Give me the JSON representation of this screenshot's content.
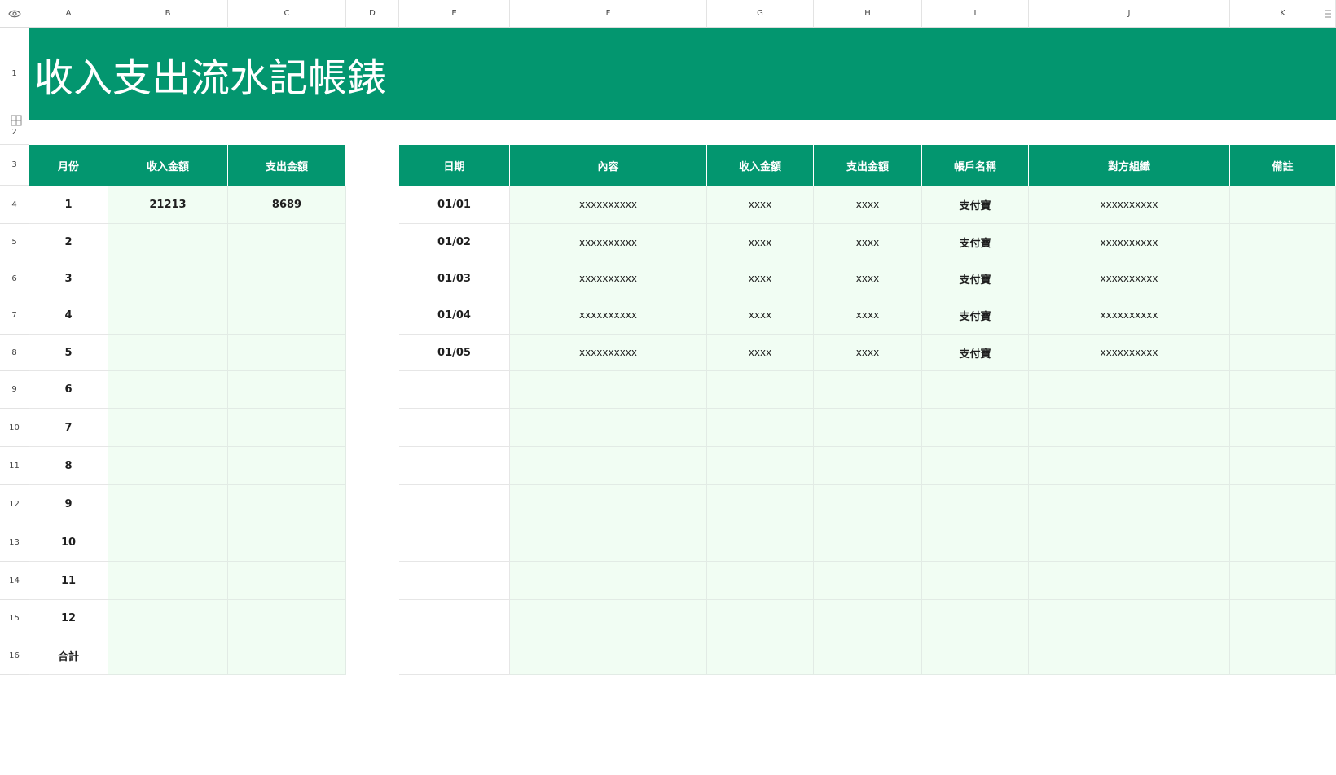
{
  "sheet": {
    "title": "收入支出流水記帳錶",
    "columns": [
      "A",
      "B",
      "C",
      "D",
      "E",
      "F",
      "G",
      "H",
      "I",
      "J",
      "K"
    ],
    "rows": [
      "1",
      "2",
      "3",
      "4",
      "5",
      "6",
      "7",
      "8",
      "9",
      "10",
      "11",
      "12",
      "13",
      "14",
      "15",
      "16"
    ],
    "left_table": {
      "headers": [
        "月份",
        "收入金額",
        "支出金額"
      ],
      "rows": [
        [
          "1",
          "21213",
          "8689"
        ],
        [
          "2",
          "",
          ""
        ],
        [
          "3",
          "",
          ""
        ],
        [
          "4",
          "",
          ""
        ],
        [
          "5",
          "",
          ""
        ],
        [
          "6",
          "",
          ""
        ],
        [
          "7",
          "",
          ""
        ],
        [
          "8",
          "",
          ""
        ],
        [
          "9",
          "",
          ""
        ],
        [
          "10",
          "",
          ""
        ],
        [
          "11",
          "",
          ""
        ],
        [
          "12",
          "",
          ""
        ],
        [
          "合計",
          "",
          ""
        ]
      ]
    },
    "right_table": {
      "headers": [
        "日期",
        "內容",
        "收入金額",
        "支出金額",
        "帳戶名稱",
        "對方組織",
        "備註"
      ],
      "rows": [
        [
          "01/01",
          "xxxxxxxxxx",
          "xxxx",
          "xxxx",
          "支付寶",
          "xxxxxxxxxx",
          ""
        ],
        [
          "01/02",
          "xxxxxxxxxx",
          "xxxx",
          "xxxx",
          "支付寶",
          "xxxxxxxxxx",
          ""
        ],
        [
          "01/03",
          "xxxxxxxxxx",
          "xxxx",
          "xxxx",
          "支付寶",
          "xxxxxxxxxx",
          ""
        ],
        [
          "01/04",
          "xxxxxxxxxx",
          "xxxx",
          "xxxx",
          "支付寶",
          "xxxxxxxxxx",
          ""
        ],
        [
          "01/05",
          "xxxxxxxxxx",
          "xxxx",
          "xxxx",
          "支付寶",
          "xxxxxxxxxx",
          ""
        ],
        [
          "",
          "",
          "",
          "",
          "",
          "",
          ""
        ],
        [
          "",
          "",
          "",
          "",
          "",
          "",
          ""
        ],
        [
          "",
          "",
          "",
          "",
          "",
          "",
          ""
        ],
        [
          "",
          "",
          "",
          "",
          "",
          "",
          ""
        ],
        [
          "",
          "",
          "",
          "",
          "",
          "",
          ""
        ],
        [
          "",
          "",
          "",
          "",
          "",
          "",
          ""
        ],
        [
          "",
          "",
          "",
          "",
          "",
          "",
          ""
        ],
        [
          "",
          "",
          "",
          "",
          "",
          "",
          ""
        ]
      ]
    }
  },
  "icons": {
    "visibility": "eye-icon",
    "freeze": "freeze-rows-icon",
    "menu": "column-menu-icon"
  },
  "colors": {
    "accent": "#03966f",
    "band": "#f1fdf3"
  }
}
